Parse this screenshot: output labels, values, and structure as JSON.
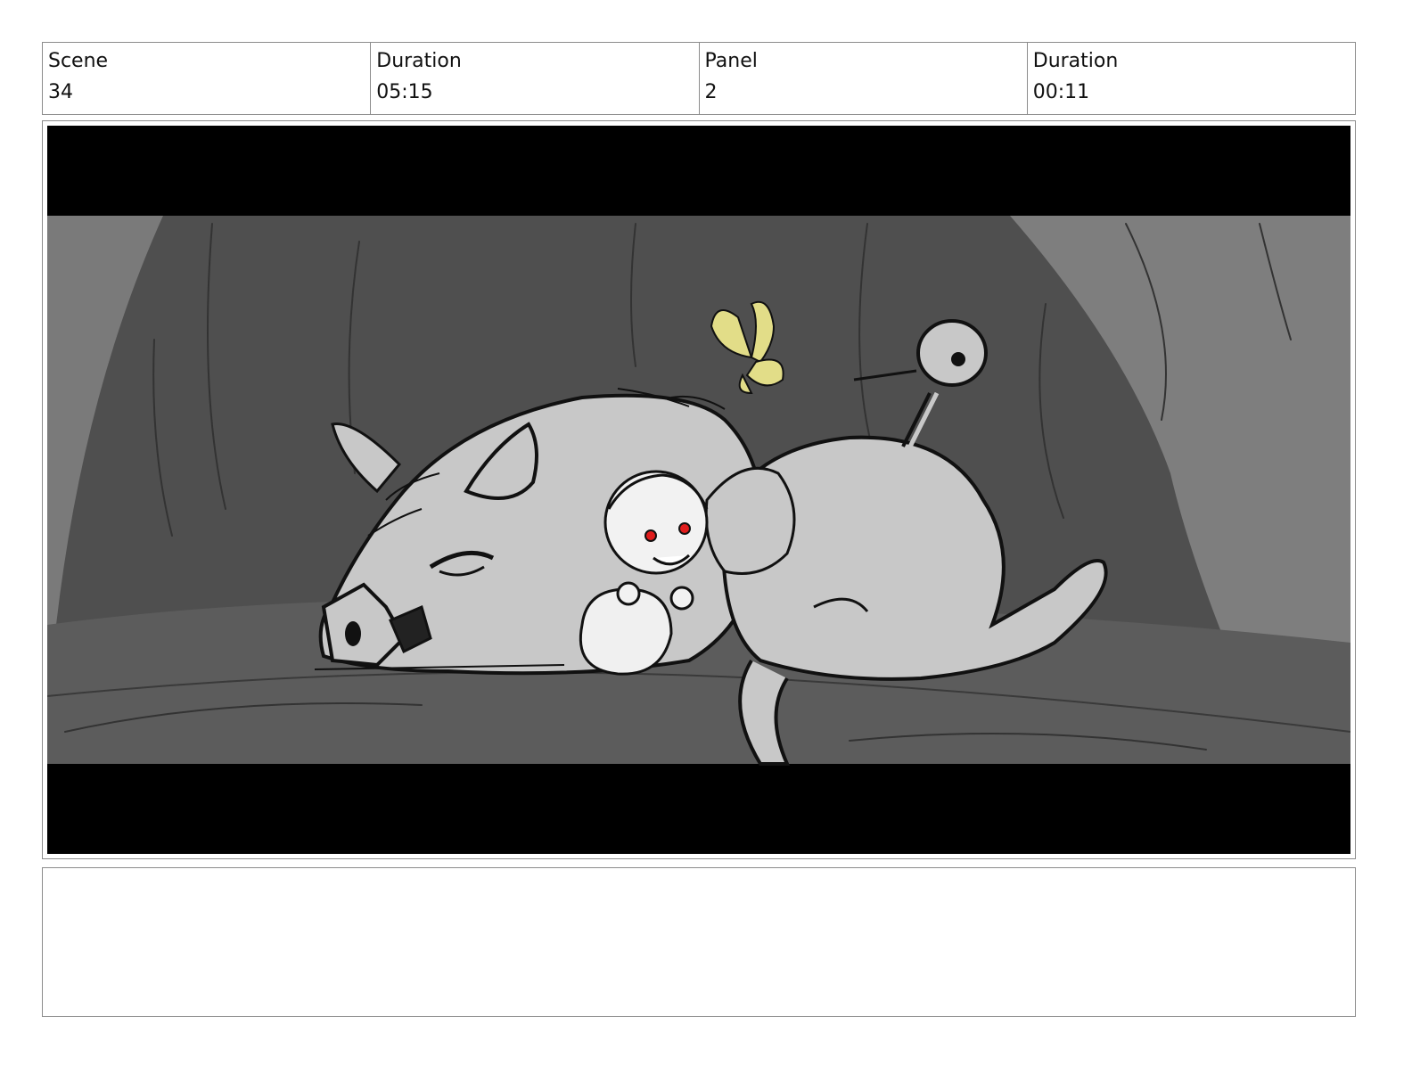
{
  "header": {
    "scene_label": "Scene",
    "scene_value": "34",
    "scene_duration_label": "Duration",
    "scene_duration_value": "05:15",
    "panel_label": "Panel",
    "panel_value": "2",
    "panel_duration_label": "Duration",
    "panel_duration_value": "00:11"
  },
  "notes": {
    "text": ""
  },
  "colors": {
    "letterbox": "#000000",
    "background_dark": "#4f4f4f",
    "background_light": "#7c7c7c",
    "creature": "#c8c8c8",
    "butterfly": "#e2dd88",
    "eyes": "#e01c1c"
  }
}
